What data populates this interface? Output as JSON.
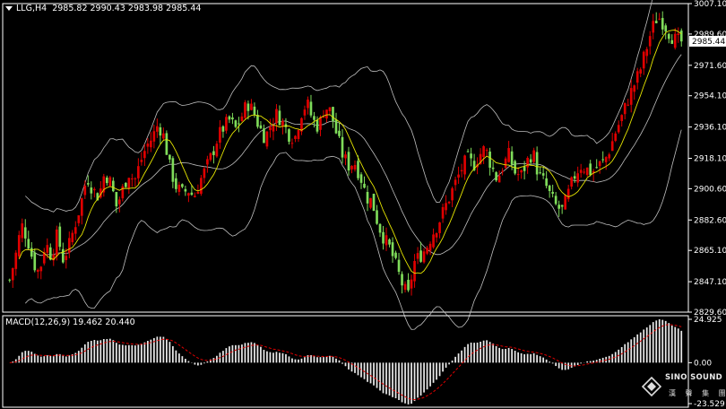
{
  "header": {
    "symbol": "LLG,H4",
    "ohlc": "2985.82 2990.43 2983.98 2985.44"
  },
  "macd_header": {
    "label": "MACD(12,26,9) 19.462 20.440"
  },
  "price_axis": {
    "ticks": [
      "3007.10",
      "2989.60",
      "2971.60",
      "2954.10",
      "2936.10",
      "2918.10",
      "2900.60",
      "2882.60",
      "2865.10",
      "2847.10",
      "2829.60"
    ],
    "current_price": "2985.44"
  },
  "macd_axis": {
    "ticks": [
      "24.925",
      "0.00",
      "-23.529"
    ]
  },
  "watermark": {
    "brand": "SINO SOUND",
    "chinese": "漢 聲 集 團"
  },
  "colors": {
    "background": "#000000",
    "bull": "#ffffff",
    "bear": "#e00000",
    "green_candle": "#7fdc5a",
    "ma": "#e6e600",
    "bands": "#bfbfbf",
    "signal": "#e00000",
    "price_marker": "#ffffff"
  },
  "chart_data": [
    {
      "type": "candlestick",
      "title": "LLG,H4",
      "ylim": [
        2829.6,
        3007.1
      ],
      "close_path": [
        2848,
        2862,
        2880,
        2872,
        2858,
        2852,
        2870,
        2862,
        2874,
        2860,
        2868,
        2880,
        2892,
        2908,
        2900,
        2896,
        2910,
        2904,
        2890,
        2900,
        2910,
        2905,
        2916,
        2925,
        2930,
        2938,
        2930,
        2912,
        2902,
        2898,
        2900,
        2896,
        2905,
        2912,
        2920,
        2930,
        2936,
        2940,
        2935,
        2942,
        2950,
        2945,
        2936,
        2930,
        2938,
        2944,
        2938,
        2932,
        2930,
        2944,
        2950,
        2940,
        2936,
        2948,
        2945,
        2932,
        2920,
        2914,
        2916,
        2908,
        2896,
        2893,
        2880,
        2872,
        2866,
        2856,
        2846,
        2838,
        2858,
        2862,
        2866,
        2874,
        2880,
        2888,
        2896,
        2904,
        2912,
        2918,
        2914,
        2920,
        2924,
        2914,
        2906,
        2914,
        2920,
        2910,
        2908,
        2916,
        2922,
        2908,
        2904,
        2896,
        2890,
        2888,
        2898,
        2908,
        2914,
        2912,
        2910,
        2914,
        2916,
        2924,
        2934,
        2942,
        2952,
        2960,
        2968,
        2980,
        2992,
        3000,
        2996,
        2990,
        2986,
        2985
      ],
      "indicators": [
        "moving-average",
        "bollinger-bands"
      ]
    },
    {
      "type": "bar",
      "title": "MACD(12,26,9) 19.462 20.440",
      "ylim": [
        -23.529,
        24.925
      ],
      "macd": 19.462,
      "signal": 20.44
    }
  ]
}
